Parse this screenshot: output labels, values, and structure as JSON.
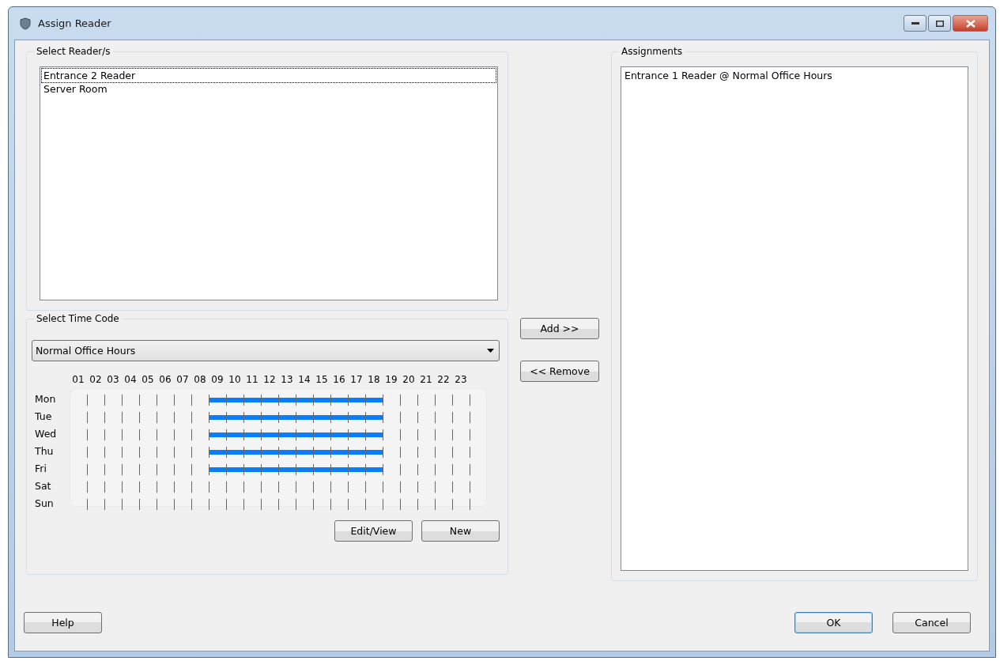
{
  "window": {
    "title": "Assign Reader"
  },
  "readers": {
    "label": "Select Reader/s",
    "items": [
      {
        "name": "Entrance 2 Reader",
        "selected": true
      },
      {
        "name": "Server Room",
        "selected": false
      }
    ]
  },
  "time_code": {
    "label": "Select Time Code",
    "value": "Normal Office Hours",
    "hours": [
      "01",
      "02",
      "03",
      "04",
      "05",
      "06",
      "07",
      "08",
      "09",
      "10",
      "11",
      "12",
      "13",
      "14",
      "15",
      "16",
      "17",
      "18",
      "19",
      "20",
      "21",
      "22",
      "23"
    ],
    "days": [
      {
        "name": "Mon",
        "active": [
          false,
          false,
          false,
          false,
          false,
          false,
          false,
          true,
          true,
          true,
          true,
          true,
          true,
          true,
          true,
          true,
          true,
          false,
          false,
          false,
          false,
          false
        ]
      },
      {
        "name": "Tue",
        "active": [
          false,
          false,
          false,
          false,
          false,
          false,
          false,
          true,
          true,
          true,
          true,
          true,
          true,
          true,
          true,
          true,
          true,
          false,
          false,
          false,
          false,
          false
        ]
      },
      {
        "name": "Wed",
        "active": [
          false,
          false,
          false,
          false,
          false,
          false,
          false,
          true,
          true,
          true,
          true,
          true,
          true,
          true,
          true,
          true,
          true,
          false,
          false,
          false,
          false,
          false
        ]
      },
      {
        "name": "Thu",
        "active": [
          false,
          false,
          false,
          false,
          false,
          false,
          false,
          true,
          true,
          true,
          true,
          true,
          true,
          true,
          true,
          true,
          true,
          false,
          false,
          false,
          false,
          false
        ]
      },
      {
        "name": "Fri",
        "active": [
          false,
          false,
          false,
          false,
          false,
          false,
          false,
          true,
          true,
          true,
          true,
          true,
          true,
          true,
          true,
          true,
          true,
          false,
          false,
          false,
          false,
          false
        ]
      },
      {
        "name": "Sat",
        "active": [
          false,
          false,
          false,
          false,
          false,
          false,
          false,
          false,
          false,
          false,
          false,
          false,
          false,
          false,
          false,
          false,
          false,
          false,
          false,
          false,
          false,
          false
        ]
      },
      {
        "name": "Sun",
        "active": [
          false,
          false,
          false,
          false,
          false,
          false,
          false,
          false,
          false,
          false,
          false,
          false,
          false,
          false,
          false,
          false,
          false,
          false,
          false,
          false,
          false,
          false
        ]
      }
    ],
    "buttons": [
      "Edit/View",
      "New"
    ]
  },
  "middle_buttons": [
    "Add >>",
    "<< Remove"
  ],
  "assignments": {
    "label": "Assignments",
    "items": [
      "Entrance 1 Reader @ Normal Office Hours"
    ]
  },
  "footer": {
    "left_button": "Help",
    "right_buttons": [
      {
        "label": "OK",
        "default": true
      },
      {
        "label": "Cancel",
        "default": false
      }
    ]
  }
}
